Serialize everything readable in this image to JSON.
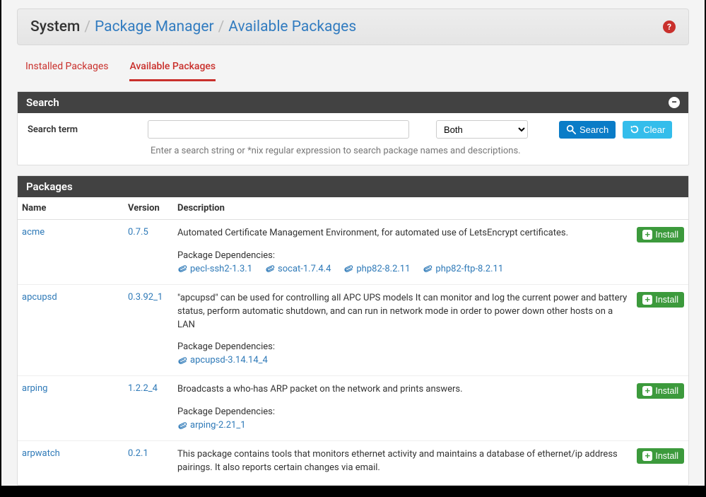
{
  "breadcrumb": {
    "root": "System",
    "mid": "Package Manager",
    "leaf": "Available Packages"
  },
  "tabs": {
    "installed": "Installed Packages",
    "available": "Available Packages"
  },
  "search_panel": {
    "title": "Search",
    "label": "Search term",
    "input_value": "",
    "select_value": "Both",
    "options": [
      "Both"
    ],
    "btn_search": "Search",
    "btn_clear": "Clear",
    "hint": "Enter a search string or *nix regular expression to search package names and descriptions."
  },
  "packages_panel": {
    "title": "Packages",
    "headers": {
      "name": "Name",
      "version": "Version",
      "description": "Description"
    },
    "install_label": "Install",
    "dep_label": "Package Dependencies:",
    "rows": [
      {
        "name": "acme",
        "version": "0.7.5",
        "desc": "Automated Certificate Management Environment, for automated use of LetsEncrypt certificates.",
        "deps": [
          "pecl-ssh2-1.3.1",
          "socat-1.7.4.4",
          "php82-8.2.11",
          "php82-ftp-8.2.11"
        ]
      },
      {
        "name": "apcupsd",
        "version": "0.3.92_1",
        "desc": "\"apcupsd\" can be used for controlling all APC UPS models It can monitor and log the current power and battery status, perform automatic shutdown, and can run in network mode in order to power down other hosts on a LAN",
        "deps": [
          "apcupsd-3.14.14_4"
        ]
      },
      {
        "name": "arping",
        "version": "1.2.2_4",
        "desc": "Broadcasts a who-has ARP packet on the network and prints answers.",
        "deps": [
          "arping-2.21_1"
        ]
      },
      {
        "name": "arpwatch",
        "version": "0.2.1",
        "desc": "This package contains tools that monitors ethernet activity and maintains a database of ethernet/ip address pairings. It also reports certain changes via email.",
        "deps": []
      }
    ]
  }
}
